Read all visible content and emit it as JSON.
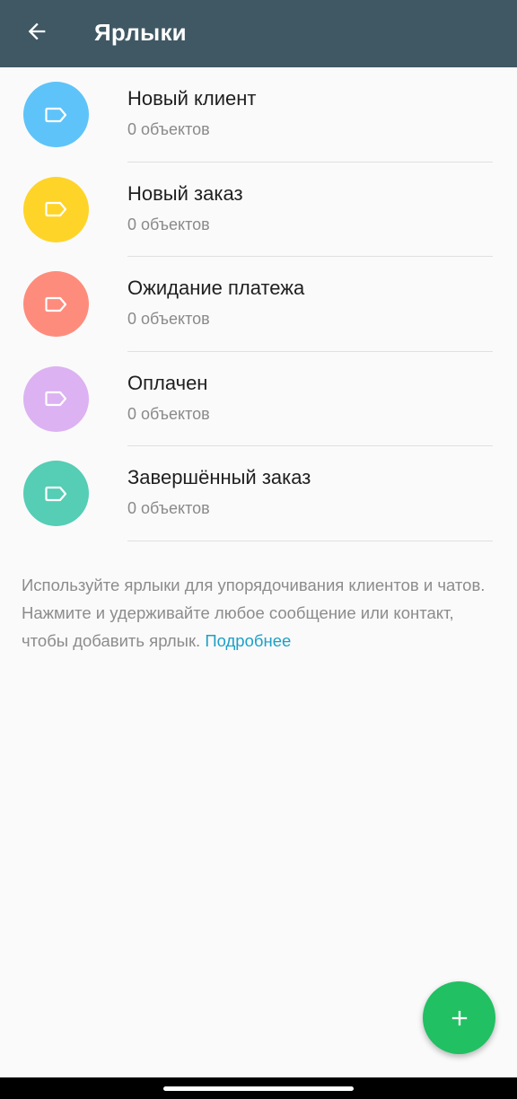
{
  "header": {
    "title": "Ярлыки"
  },
  "labels": [
    {
      "name": "Новый клиент",
      "count": "0 объектов",
      "color": "#5ec3f9"
    },
    {
      "name": "Новый заказ",
      "count": "0 объектов",
      "color": "#fed428"
    },
    {
      "name": "Ожидание платежа",
      "count": "0 объектов",
      "color": "#fe8c7c"
    },
    {
      "name": "Оплачен",
      "count": "0 объектов",
      "color": "#dcb2f2"
    },
    {
      "name": "Завершённый заказ",
      "count": "0 объектов",
      "color": "#56cdb5"
    }
  ],
  "info": {
    "text": "Используйте ярлыки для упорядочивания клиентов и чатов. Нажмите и удерживайте любое сообщение или контакт, чтобы добавить ярлык. ",
    "link": "Подробнее"
  },
  "colors": {
    "app_bar": "#3f5864",
    "fab": "#21c063",
    "link": "#1e9fc8"
  },
  "icons": {
    "back": "arrow-left-icon",
    "label": "tag-icon",
    "fab": "plus-icon"
  }
}
